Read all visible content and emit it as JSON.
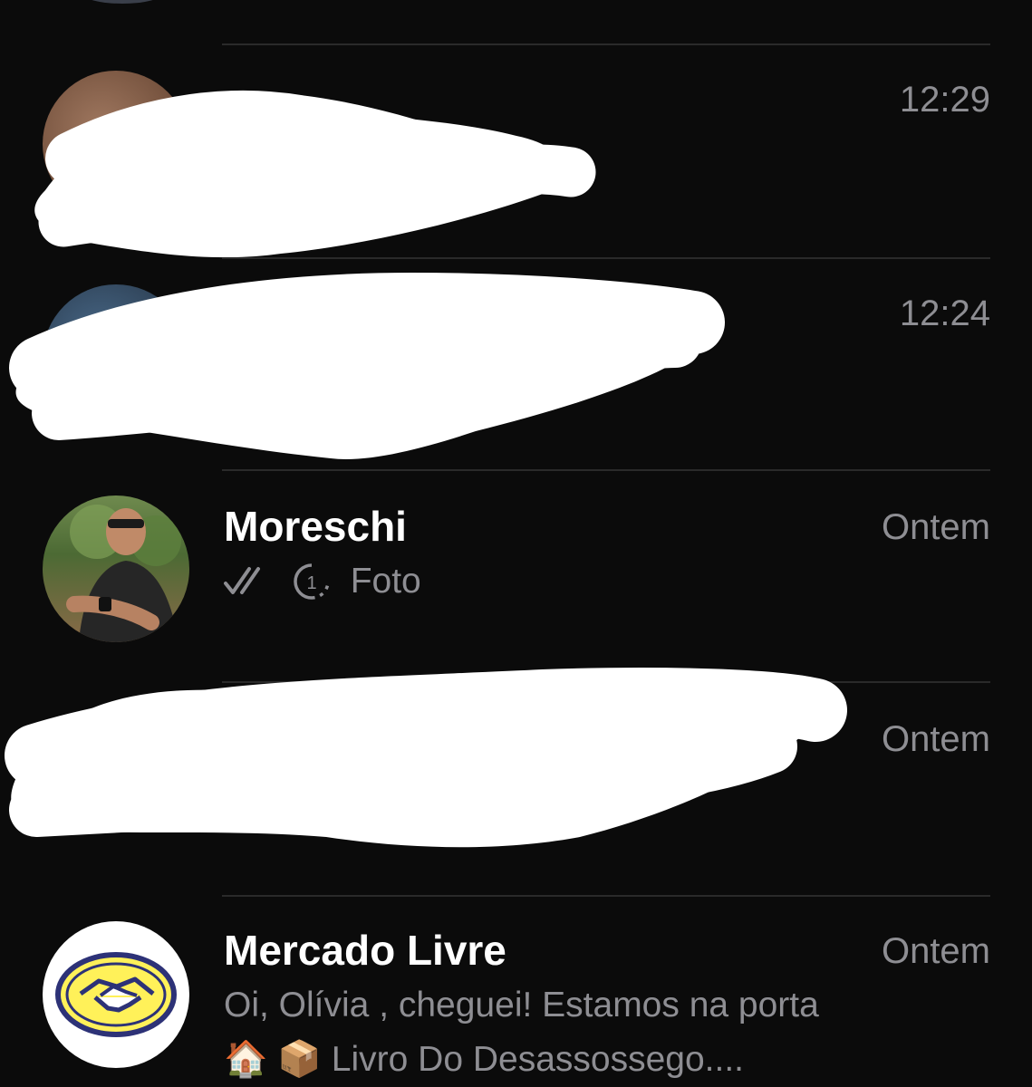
{
  "chats": [
    {
      "name": "",
      "time": "12:29",
      "preview": ""
    },
    {
      "name": "",
      "time": "12:24",
      "preview": ""
    },
    {
      "name": "Moreschi",
      "time": "Ontem",
      "preview": "Foto",
      "status": "double-check-icon",
      "media": "view-once-icon"
    },
    {
      "name": "",
      "time": "Ontem",
      "preview": ""
    },
    {
      "name": "Mercado Livre",
      "time": "Ontem",
      "preview_line1": "Oi, Olívia , cheguei! Estamos na porta",
      "preview_line2": "🏠 📦 Livro Do Desassossego...."
    }
  ],
  "colors": {
    "background": "#0b0b0b",
    "secondary_text": "#8e8e93",
    "divider": "#2a2a2a",
    "mercado_livre_yellow": "#fff159",
    "mercado_livre_blue": "#2d3277"
  }
}
